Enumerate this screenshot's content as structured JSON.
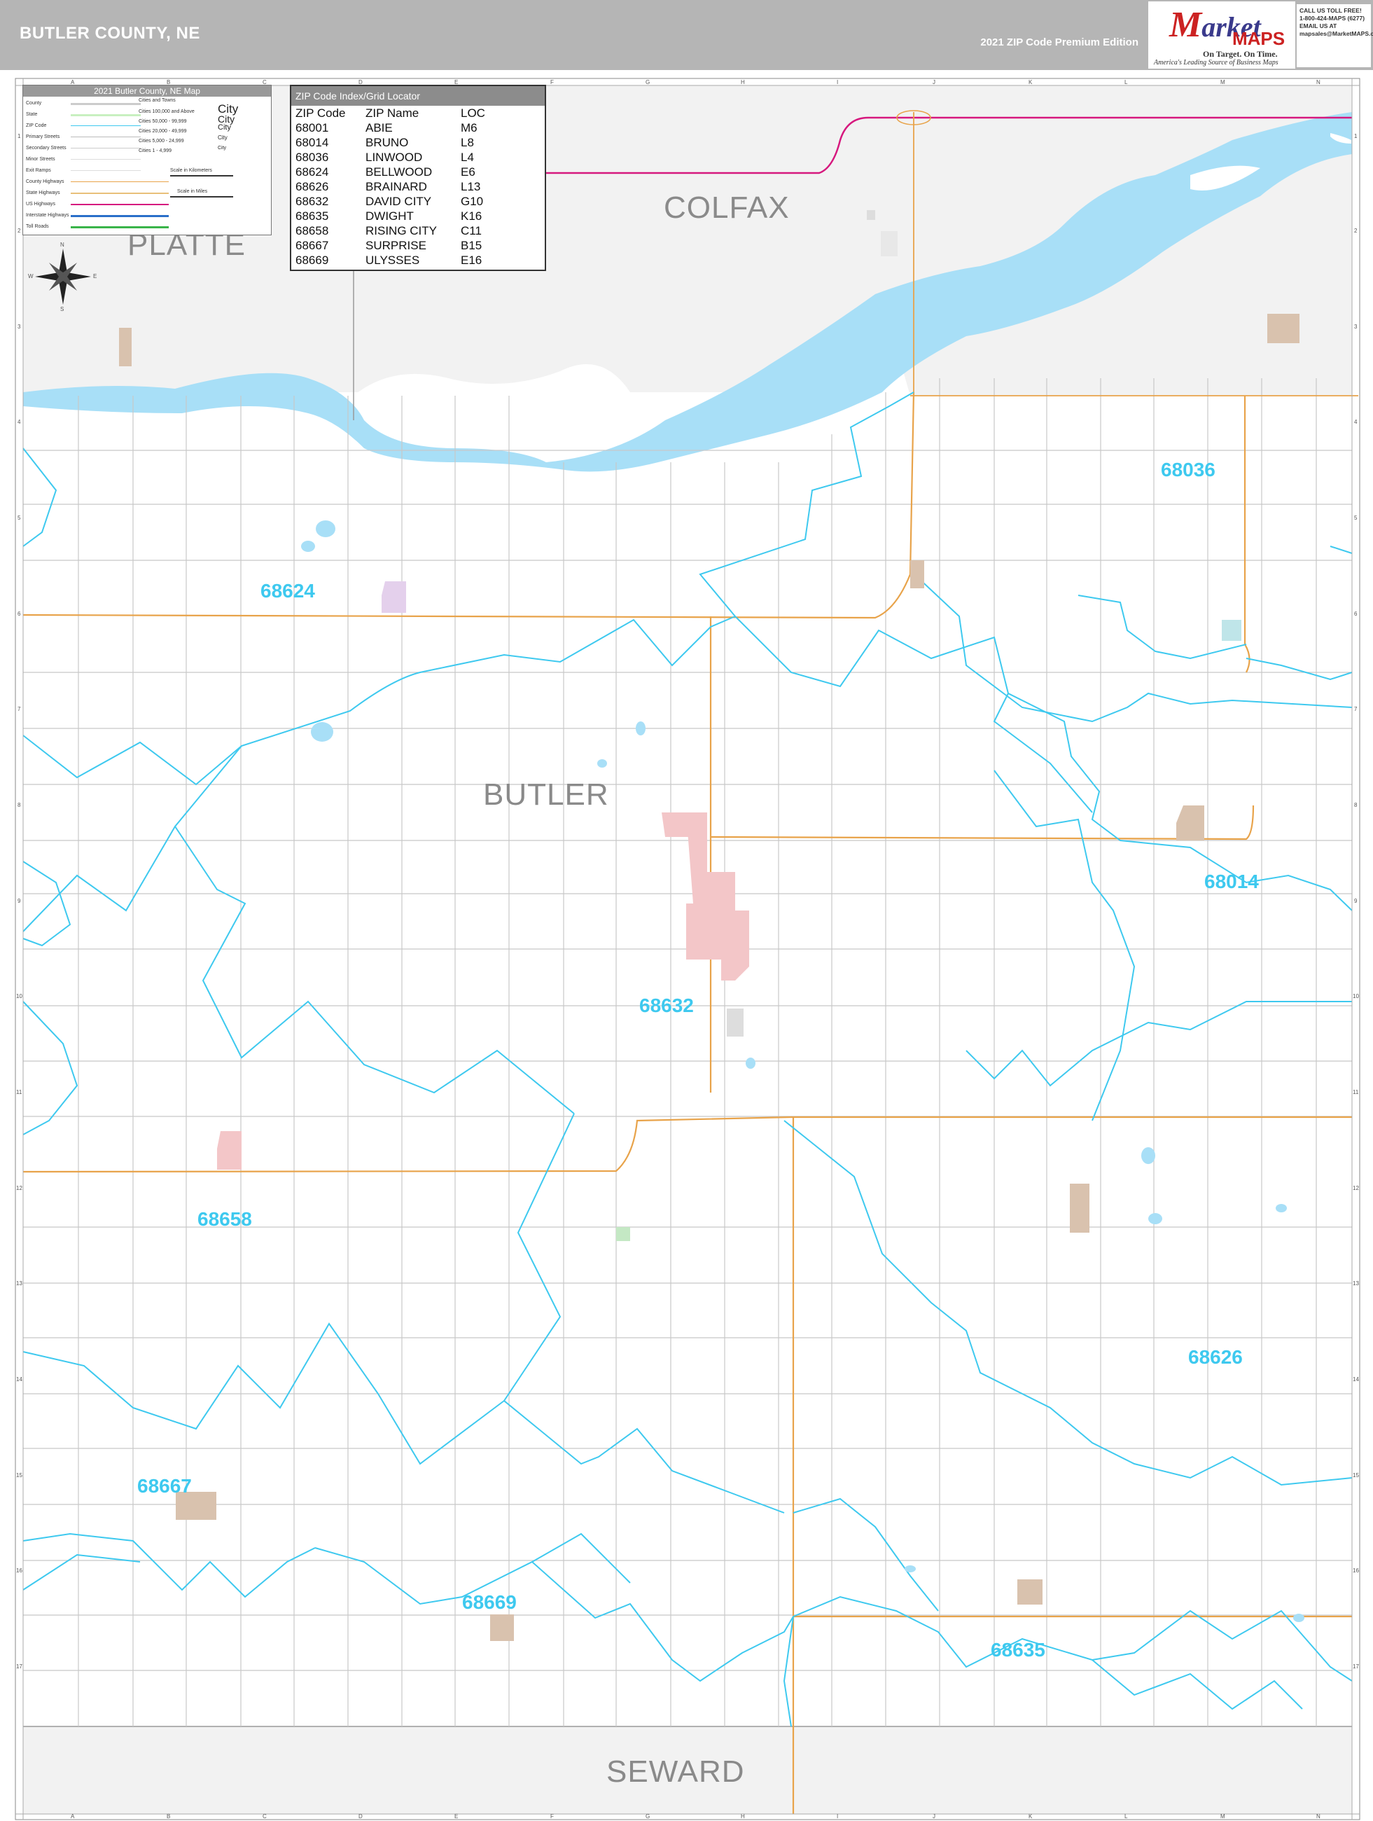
{
  "header": {
    "title": "BUTLER COUNTY, NE",
    "edition": "2021 ZIP Code Premium Edition",
    "logo_brand": "Market",
    "logo_brand_initial": "M",
    "logo_brand_rest": "arket",
    "logo_maps": "MAPS",
    "logo_tagline": "On Target. On Time.",
    "logo_subtag": "America's Leading Source of Business Maps",
    "contact": [
      "CALL US TOLL FREE!",
      "1-800-424-MAPS (6277)",
      "",
      "EMAIL US AT",
      "mapsales@MarketMAPS.com"
    ]
  },
  "legend": {
    "title": "2021 Butler County, NE Map",
    "items": [
      "County",
      "State",
      "ZIP Code",
      "Primary Streets",
      "Secondary Streets",
      "Minor Streets",
      "Exit Ramps",
      "County Highways",
      "State Highways",
      "US Highways",
      "Interstate Highways",
      "Toll Roads"
    ],
    "cities_header": "Cities and Towns",
    "city_classes": [
      "Cities 100,000 and Above",
      "Cities 50,000 - 99,999",
      "Cities 20,000 - 49,999",
      "Cities 5,000 - 24,999",
      "Cities 1 - 4,999"
    ],
    "city_samples": [
      "City",
      "City",
      "City",
      "City",
      "City"
    ],
    "scale_km": "Scale in Kilometers",
    "scale_mi": "Scale in Miles"
  },
  "zip_index": {
    "title": "ZIP Code Index/Grid Locator",
    "headers": [
      "ZIP Code",
      "ZIP Name",
      "LOC"
    ],
    "rows": [
      [
        "68001",
        "ABIE",
        "M6"
      ],
      [
        "68014",
        "BRUNO",
        "L8"
      ],
      [
        "68036",
        "LINWOOD",
        "L4"
      ],
      [
        "68624",
        "BELLWOOD",
        "E6"
      ],
      [
        "68626",
        "BRAINARD",
        "L13"
      ],
      [
        "68632",
        "DAVID CITY",
        "G10"
      ],
      [
        "68635",
        "DWIGHT",
        "K16"
      ],
      [
        "68658",
        "RISING CITY",
        "C11"
      ],
      [
        "68667",
        "SURPRISE",
        "B15"
      ],
      [
        "68669",
        "ULYSSES",
        "E16"
      ]
    ]
  },
  "counties": {
    "platte": "PLATTE",
    "colfax": "COLFAX",
    "butler": "BUTLER",
    "seward": "SEWARD"
  },
  "zip_labels": {
    "z68036": "68036",
    "z68624": "68624",
    "z68014": "68014",
    "z68632": "68632",
    "z68658": "68658",
    "z68626": "68626",
    "z68667": "68667",
    "z68669": "68669",
    "z68635": "68635"
  },
  "compass": [
    "N",
    "S",
    "E",
    "W"
  ],
  "grid_letters": [
    "A",
    "B",
    "C",
    "D",
    "E",
    "F",
    "G",
    "H",
    "I",
    "J",
    "K",
    "L",
    "M",
    "N"
  ],
  "grid_numbers": [
    "1",
    "2",
    "3",
    "4",
    "5",
    "6",
    "7",
    "8",
    "9",
    "10",
    "11",
    "12",
    "13",
    "14",
    "15",
    "16",
    "17"
  ],
  "colors": {
    "water": "#a8dff7",
    "zip_boundary": "#3ec9ef",
    "county_fill": "#f2f2f2",
    "highway": "#e8a34a",
    "us_highway": "#d6187e",
    "city_fill": "#f3c6c8",
    "town_fill": "#d9c2ae",
    "header_bg": "#b5b5b5"
  }
}
